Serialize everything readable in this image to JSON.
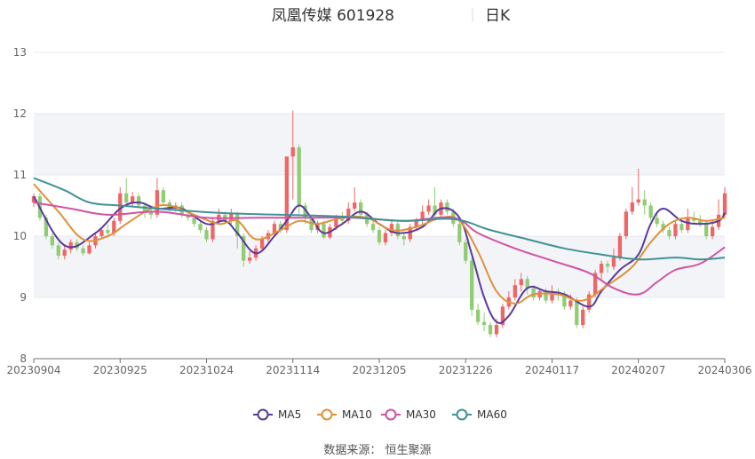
{
  "title": {
    "name": "凤凰传媒 601928",
    "period": "日K"
  },
  "source": "数据来源： 恒生聚源",
  "colors": {
    "up": "#ee6666",
    "down": "#91cc75",
    "MA5": "#5a3a9b",
    "MA10": "#e0913a",
    "MA30": "#d053a2",
    "MA60": "#3f9396",
    "grid": "#e6e9f0",
    "band": "#f3f4f8",
    "axis": "#6e7079"
  },
  "chart_data": {
    "type": "candlestick",
    "title": "凤凰传媒 601928",
    "subtitle": "日K",
    "ylim": [
      8,
      13
    ],
    "yticks": [
      8,
      9,
      10,
      11,
      12,
      13
    ],
    "xtick_labels": [
      "20230904",
      "20230925",
      "20231024",
      "20231114",
      "20231205",
      "20231226",
      "20240117",
      "20240207",
      "20240306"
    ],
    "xtick_index": [
      0,
      14,
      28,
      42,
      56,
      70,
      84,
      98,
      112
    ],
    "n_days": 113,
    "grid": true,
    "legend_position": "bottom",
    "candles": [
      [
        10.55,
        10.65,
        10.48,
        10.7
      ],
      [
        10.65,
        10.3,
        10.25,
        10.7
      ],
      [
        10.3,
        10.0,
        9.95,
        10.35
      ],
      [
        10.0,
        9.85,
        9.8,
        10.05
      ],
      [
        9.85,
        9.68,
        9.62,
        9.9
      ],
      [
        9.68,
        9.78,
        9.62,
        9.85
      ],
      [
        9.78,
        9.9,
        9.72,
        9.95
      ],
      [
        9.9,
        9.8,
        9.75,
        9.95
      ],
      [
        9.8,
        9.72,
        9.68,
        9.85
      ],
      [
        9.72,
        9.85,
        9.7,
        9.9
      ],
      [
        9.85,
        10.0,
        9.8,
        10.05
      ],
      [
        10.0,
        10.1,
        9.95,
        10.15
      ],
      [
        10.1,
        10.05,
        9.98,
        10.2
      ],
      [
        10.05,
        10.25,
        10.0,
        10.3
      ],
      [
        10.25,
        10.7,
        10.2,
        10.8
      ],
      [
        10.7,
        10.55,
        10.5,
        10.95
      ],
      [
        10.55,
        10.65,
        10.5,
        10.72
      ],
      [
        10.65,
        10.5,
        10.45,
        10.7
      ],
      [
        10.5,
        10.4,
        10.3,
        10.55
      ],
      [
        10.4,
        10.35,
        10.28,
        10.45
      ],
      [
        10.35,
        10.75,
        10.3,
        10.95
      ],
      [
        10.75,
        10.55,
        10.5,
        10.8
      ],
      [
        10.55,
        10.45,
        10.4,
        10.6
      ],
      [
        10.45,
        10.5,
        10.4,
        10.55
      ],
      [
        10.5,
        10.35,
        10.3,
        10.55
      ],
      [
        10.35,
        10.3,
        10.25,
        10.4
      ],
      [
        10.3,
        10.2,
        10.15,
        10.35
      ],
      [
        10.2,
        10.1,
        10.05,
        10.25
      ],
      [
        10.1,
        9.95,
        9.9,
        10.15
      ],
      [
        9.95,
        10.25,
        9.9,
        10.3
      ],
      [
        10.25,
        10.35,
        10.2,
        10.45
      ],
      [
        10.35,
        10.25,
        10.2,
        10.4
      ],
      [
        10.25,
        10.38,
        10.2,
        10.45
      ],
      [
        10.38,
        10.0,
        9.8,
        10.4
      ],
      [
        10.0,
        9.6,
        9.5,
        10.05
      ],
      [
        9.6,
        9.65,
        9.55,
        9.75
      ],
      [
        9.65,
        9.8,
        9.6,
        9.85
      ],
      [
        9.8,
        9.95,
        9.75,
        10.0
      ],
      [
        9.95,
        10.05,
        9.9,
        10.1
      ],
      [
        10.05,
        10.2,
        10.0,
        10.25
      ],
      [
        10.2,
        10.1,
        10.05,
        10.25
      ],
      [
        10.1,
        11.3,
        10.05,
        11.3
      ],
      [
        11.3,
        11.45,
        10.6,
        12.05
      ],
      [
        11.45,
        10.5,
        10.35,
        11.5
      ],
      [
        10.5,
        10.3,
        10.2,
        10.55
      ],
      [
        10.3,
        10.1,
        10.05,
        10.35
      ],
      [
        10.1,
        10.2,
        10.05,
        10.25
      ],
      [
        10.2,
        9.98,
        9.95,
        10.25
      ],
      [
        9.98,
        10.15,
        9.95,
        10.2
      ],
      [
        10.15,
        10.3,
        10.1,
        10.35
      ],
      [
        10.3,
        10.25,
        10.2,
        10.4
      ],
      [
        10.25,
        10.45,
        10.2,
        10.55
      ],
      [
        10.45,
        10.55,
        10.4,
        10.8
      ],
      [
        10.55,
        10.35,
        10.3,
        10.6
      ],
      [
        10.35,
        10.2,
        10.15,
        10.4
      ],
      [
        10.2,
        10.1,
        10.05,
        10.25
      ],
      [
        10.1,
        9.9,
        9.85,
        10.15
      ],
      [
        9.9,
        10.05,
        9.85,
        10.1
      ],
      [
        10.05,
        10.2,
        10.0,
        10.25
      ],
      [
        10.2,
        10.0,
        9.95,
        10.25
      ],
      [
        10.0,
        9.95,
        9.85,
        10.05
      ],
      [
        9.95,
        10.15,
        9.9,
        10.2
      ],
      [
        10.15,
        10.25,
        10.1,
        10.3
      ],
      [
        10.25,
        10.4,
        10.2,
        10.5
      ],
      [
        10.4,
        10.5,
        10.35,
        10.6
      ],
      [
        10.5,
        10.35,
        10.3,
        10.8
      ],
      [
        10.35,
        10.55,
        10.3,
        10.6
      ],
      [
        10.55,
        10.4,
        10.35,
        10.6
      ],
      [
        10.4,
        10.2,
        10.15,
        10.45
      ],
      [
        10.2,
        9.9,
        9.85,
        10.25
      ],
      [
        9.9,
        9.6,
        9.55,
        9.95
      ],
      [
        9.6,
        8.8,
        8.7,
        9.65
      ],
      [
        8.8,
        8.6,
        8.55,
        8.9
      ],
      [
        8.6,
        8.55,
        8.45,
        8.75
      ],
      [
        8.55,
        8.4,
        8.35,
        8.6
      ],
      [
        8.4,
        8.55,
        8.35,
        8.65
      ],
      [
        8.55,
        8.85,
        8.5,
        8.9
      ],
      [
        8.85,
        9.0,
        8.8,
        9.1
      ],
      [
        9.0,
        9.2,
        8.95,
        9.3
      ],
      [
        9.2,
        9.3,
        9.1,
        9.4
      ],
      [
        9.3,
        9.15,
        9.05,
        9.35
      ],
      [
        9.15,
        9.0,
        8.95,
        9.2
      ],
      [
        9.0,
        9.1,
        8.95,
        9.15
      ],
      [
        9.1,
        8.95,
        8.9,
        9.15
      ],
      [
        8.95,
        9.1,
        8.9,
        9.2
      ],
      [
        9.1,
        9.05,
        8.95,
        9.15
      ],
      [
        9.05,
        8.85,
        8.8,
        9.1
      ],
      [
        8.85,
        8.95,
        8.8,
        9.05
      ],
      [
        8.95,
        8.55,
        8.5,
        9.0
      ],
      [
        8.55,
        8.8,
        8.5,
        8.85
      ],
      [
        8.8,
        9.05,
        8.75,
        9.1
      ],
      [
        9.05,
        9.4,
        9.0,
        9.45
      ],
      [
        9.4,
        9.55,
        9.3,
        9.6
      ],
      [
        9.55,
        9.5,
        9.4,
        9.6
      ],
      [
        9.5,
        9.65,
        9.45,
        9.8
      ],
      [
        9.65,
        10.0,
        9.6,
        10.05
      ],
      [
        10.0,
        10.4,
        9.95,
        10.45
      ],
      [
        10.4,
        10.55,
        10.35,
        10.8
      ],
      [
        10.55,
        10.6,
        10.5,
        11.1
      ],
      [
        10.6,
        10.5,
        10.35,
        10.75
      ],
      [
        10.5,
        10.3,
        10.25,
        10.55
      ],
      [
        10.3,
        10.2,
        10.15,
        10.4
      ],
      [
        10.2,
        10.1,
        10.05,
        10.25
      ],
      [
        10.1,
        10.0,
        9.95,
        10.15
      ],
      [
        10.0,
        10.2,
        9.95,
        10.25
      ],
      [
        10.2,
        10.1,
        10.05,
        10.3
      ],
      [
        10.1,
        10.3,
        10.05,
        10.45
      ],
      [
        10.3,
        10.25,
        10.2,
        10.4
      ],
      [
        10.25,
        10.2,
        10.15,
        10.35
      ],
      [
        10.2,
        10.0,
        9.95,
        10.25
      ],
      [
        10.0,
        10.15,
        9.95,
        10.25
      ],
      [
        10.15,
        10.35,
        10.1,
        10.6
      ],
      [
        10.35,
        10.7,
        10.3,
        10.8
      ]
    ],
    "series": [
      {
        "name": "MA5",
        "anchors": [
          [
            0,
            10.65
          ],
          [
            5,
            9.85
          ],
          [
            10,
            10.05
          ],
          [
            14,
            10.45
          ],
          [
            17,
            10.55
          ],
          [
            20,
            10.45
          ],
          [
            24,
            10.45
          ],
          [
            28,
            10.2
          ],
          [
            31,
            10.25
          ],
          [
            33,
            10.05
          ],
          [
            36,
            9.72
          ],
          [
            39,
            10.0
          ],
          [
            41,
            10.25
          ],
          [
            43,
            10.5
          ],
          [
            45,
            10.3
          ],
          [
            47,
            10.05
          ],
          [
            50,
            10.2
          ],
          [
            53,
            10.4
          ],
          [
            56,
            10.2
          ],
          [
            59,
            10.05
          ],
          [
            63,
            10.15
          ],
          [
            66,
            10.45
          ],
          [
            69,
            10.3
          ],
          [
            71,
            9.7
          ],
          [
            73,
            9.0
          ],
          [
            75,
            8.6
          ],
          [
            77,
            8.7
          ],
          [
            80,
            9.15
          ],
          [
            83,
            9.1
          ],
          [
            86,
            9.05
          ],
          [
            90,
            8.85
          ],
          [
            92,
            9.1
          ],
          [
            95,
            9.45
          ],
          [
            98,
            9.7
          ],
          [
            100,
            10.2
          ],
          [
            102,
            10.45
          ],
          [
            105,
            10.25
          ],
          [
            108,
            10.2
          ],
          [
            111,
            10.25
          ],
          [
            112,
            10.38
          ]
        ]
      },
      {
        "name": "MA10",
        "anchors": [
          [
            0,
            10.85
          ],
          [
            4,
            10.4
          ],
          [
            8,
            9.95
          ],
          [
            12,
            10.0
          ],
          [
            15,
            10.2
          ],
          [
            19,
            10.45
          ],
          [
            22,
            10.5
          ],
          [
            26,
            10.35
          ],
          [
            30,
            10.2
          ],
          [
            33,
            10.25
          ],
          [
            36,
            9.95
          ],
          [
            40,
            10.1
          ],
          [
            43,
            10.25
          ],
          [
            46,
            10.2
          ],
          [
            50,
            10.3
          ],
          [
            54,
            10.3
          ],
          [
            58,
            10.1
          ],
          [
            62,
            10.15
          ],
          [
            66,
            10.3
          ],
          [
            69,
            10.25
          ],
          [
            72,
            9.75
          ],
          [
            75,
            9.1
          ],
          [
            78,
            8.9
          ],
          [
            81,
            9.05
          ],
          [
            85,
            9.05
          ],
          [
            89,
            8.95
          ],
          [
            93,
            9.2
          ],
          [
            97,
            9.5
          ],
          [
            100,
            9.9
          ],
          [
            103,
            10.2
          ],
          [
            106,
            10.3
          ],
          [
            109,
            10.25
          ],
          [
            112,
            10.3
          ]
        ]
      },
      {
        "name": "MA30",
        "anchors": [
          [
            0,
            10.55
          ],
          [
            6,
            10.45
          ],
          [
            12,
            10.35
          ],
          [
            20,
            10.4
          ],
          [
            28,
            10.3
          ],
          [
            36,
            10.3
          ],
          [
            44,
            10.3
          ],
          [
            52,
            10.3
          ],
          [
            60,
            10.25
          ],
          [
            68,
            10.3
          ],
          [
            72,
            10.05
          ],
          [
            78,
            9.8
          ],
          [
            84,
            9.6
          ],
          [
            90,
            9.4
          ],
          [
            94,
            9.15
          ],
          [
            98,
            9.05
          ],
          [
            101,
            9.25
          ],
          [
            104,
            9.45
          ],
          [
            108,
            9.55
          ],
          [
            112,
            9.82
          ]
        ]
      },
      {
        "name": "MA60",
        "anchors": [
          [
            0,
            10.95
          ],
          [
            5,
            10.75
          ],
          [
            9,
            10.55
          ],
          [
            14,
            10.5
          ],
          [
            20,
            10.45
          ],
          [
            30,
            10.38
          ],
          [
            40,
            10.35
          ],
          [
            50,
            10.32
          ],
          [
            60,
            10.25
          ],
          [
            68,
            10.28
          ],
          [
            74,
            10.1
          ],
          [
            80,
            9.95
          ],
          [
            86,
            9.8
          ],
          [
            92,
            9.7
          ],
          [
            98,
            9.62
          ],
          [
            104,
            9.65
          ],
          [
            108,
            9.62
          ],
          [
            112,
            9.65
          ]
        ]
      }
    ]
  }
}
